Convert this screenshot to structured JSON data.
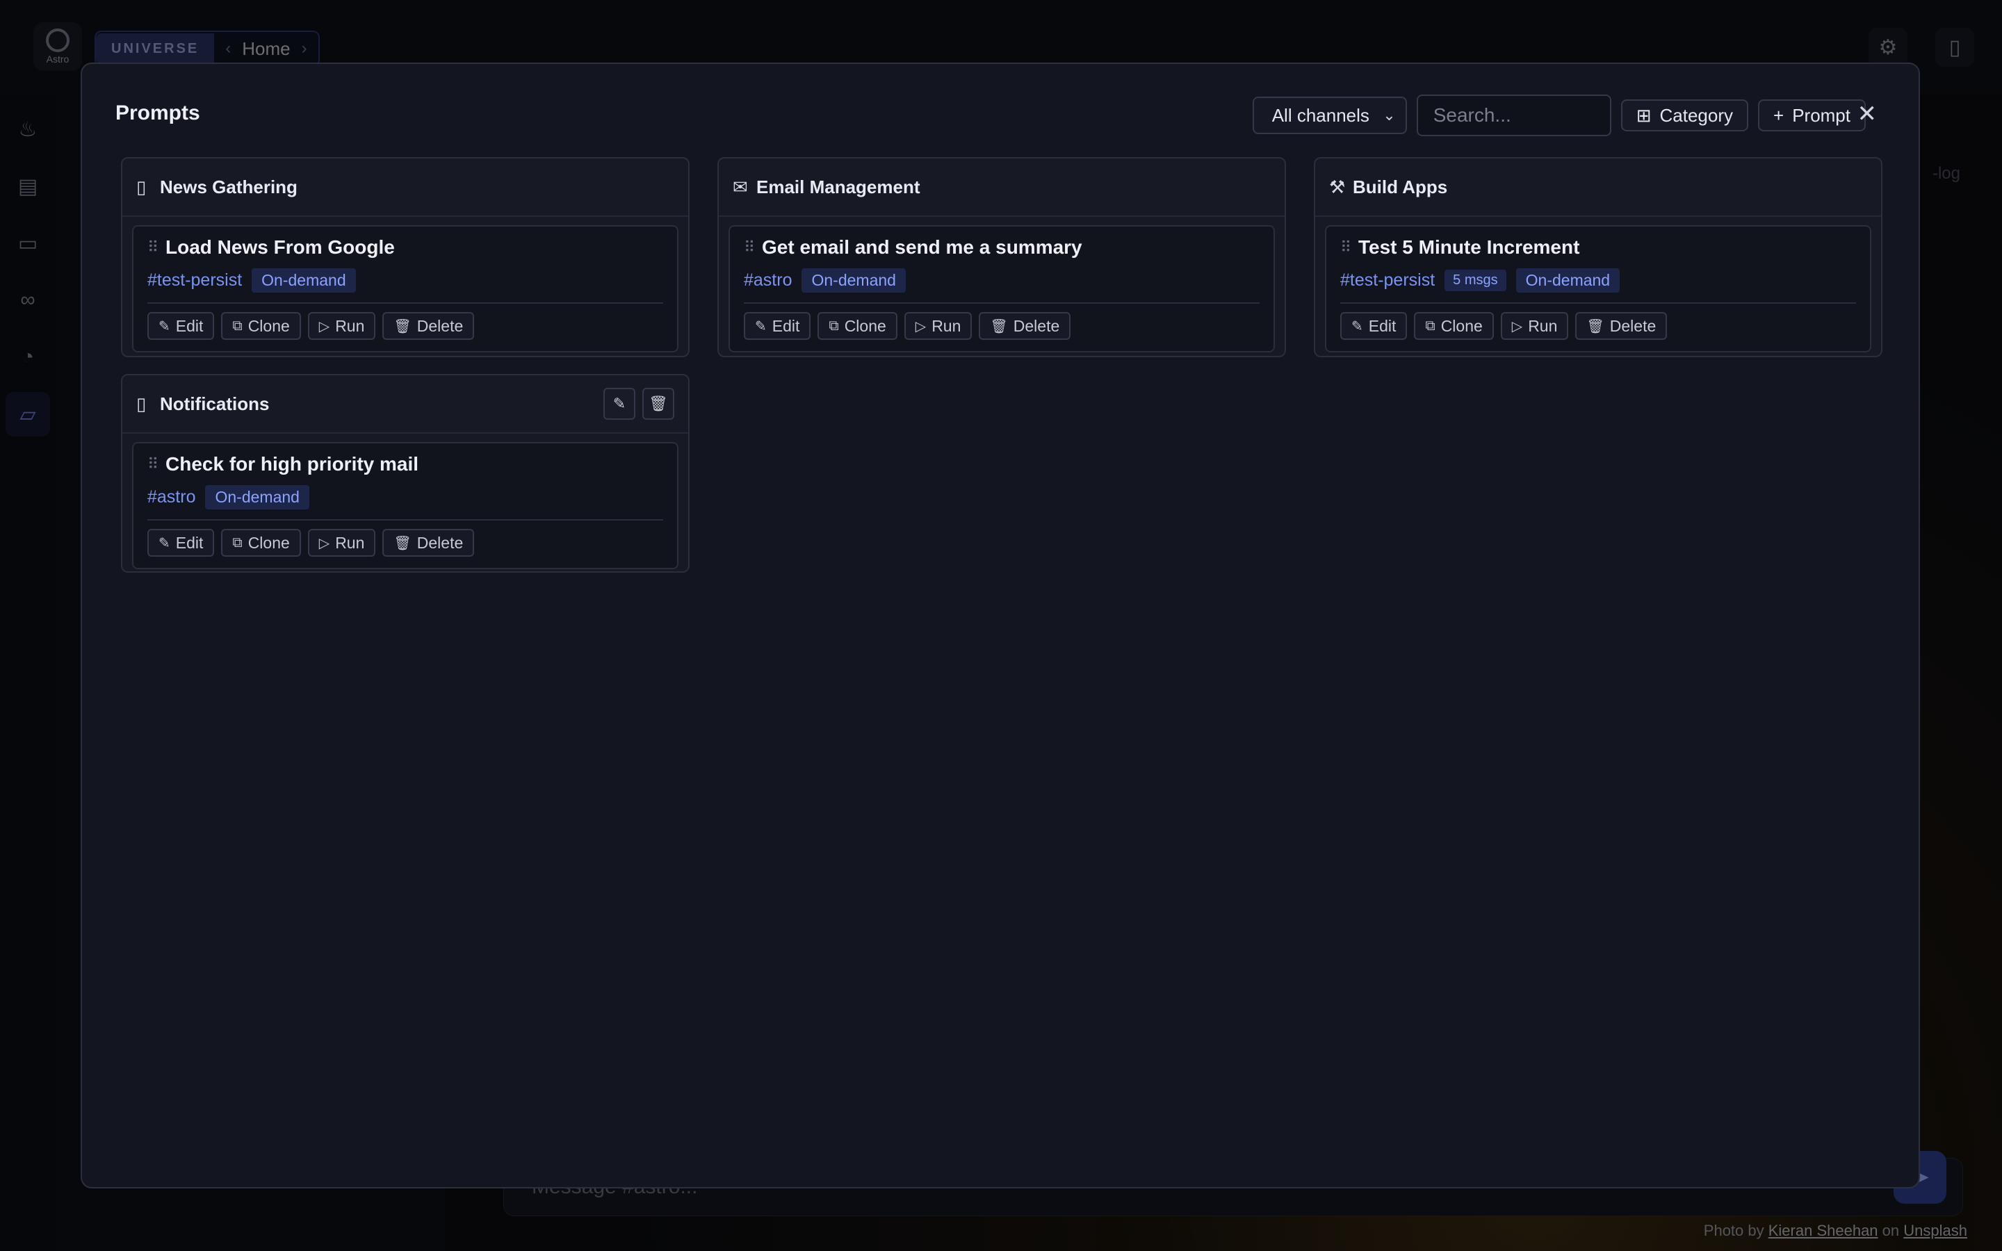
{
  "app": {
    "logo_text": "Astro",
    "breadcrumb": {
      "universe": "UNIVERSE",
      "prev": "‹",
      "current": "Home",
      "next": "›"
    },
    "bg_tag": "-log",
    "composer_placeholder": "Message #astro...",
    "credit": {
      "prefix": "Photo by",
      "author": "Kieran Sheehan",
      "on": "on",
      "site": "Unsplash"
    }
  },
  "modal": {
    "title": "Prompts",
    "channel_filter": "All channels",
    "search_placeholder": "Search...",
    "add_category_label": "Category",
    "add_prompt_label": "Prompt",
    "action_labels": {
      "edit": "Edit",
      "clone": "Clone",
      "run": "Run",
      "delete": "Delete"
    },
    "categories": [
      {
        "title": "News Gathering",
        "icon": "▯",
        "prompts": [
          {
            "title": "Load News From Google",
            "channel": "#test-persist",
            "mode": "On-demand"
          }
        ]
      },
      {
        "title": "Email Management",
        "icon": "✉",
        "prompts": [
          {
            "title": "Get email and send me a summary",
            "channel": "#astro",
            "mode": "On-demand"
          }
        ]
      },
      {
        "title": "Build Apps",
        "icon": "⚒",
        "prompts": [
          {
            "title": "Test 5 Minute Increment",
            "channel": "#test-persist",
            "msgs": "5 msgs",
            "mode": "On-demand"
          }
        ]
      },
      {
        "title": "Notifications",
        "icon": "▯",
        "prompts": [
          {
            "title": "Check for high priority mail",
            "channel": "#astro",
            "mode": "On-demand"
          }
        ]
      }
    ]
  },
  "colors": {
    "accent": "#7b93f3",
    "badge_bg": "#1d2548",
    "modal_bg": "#131520"
  }
}
